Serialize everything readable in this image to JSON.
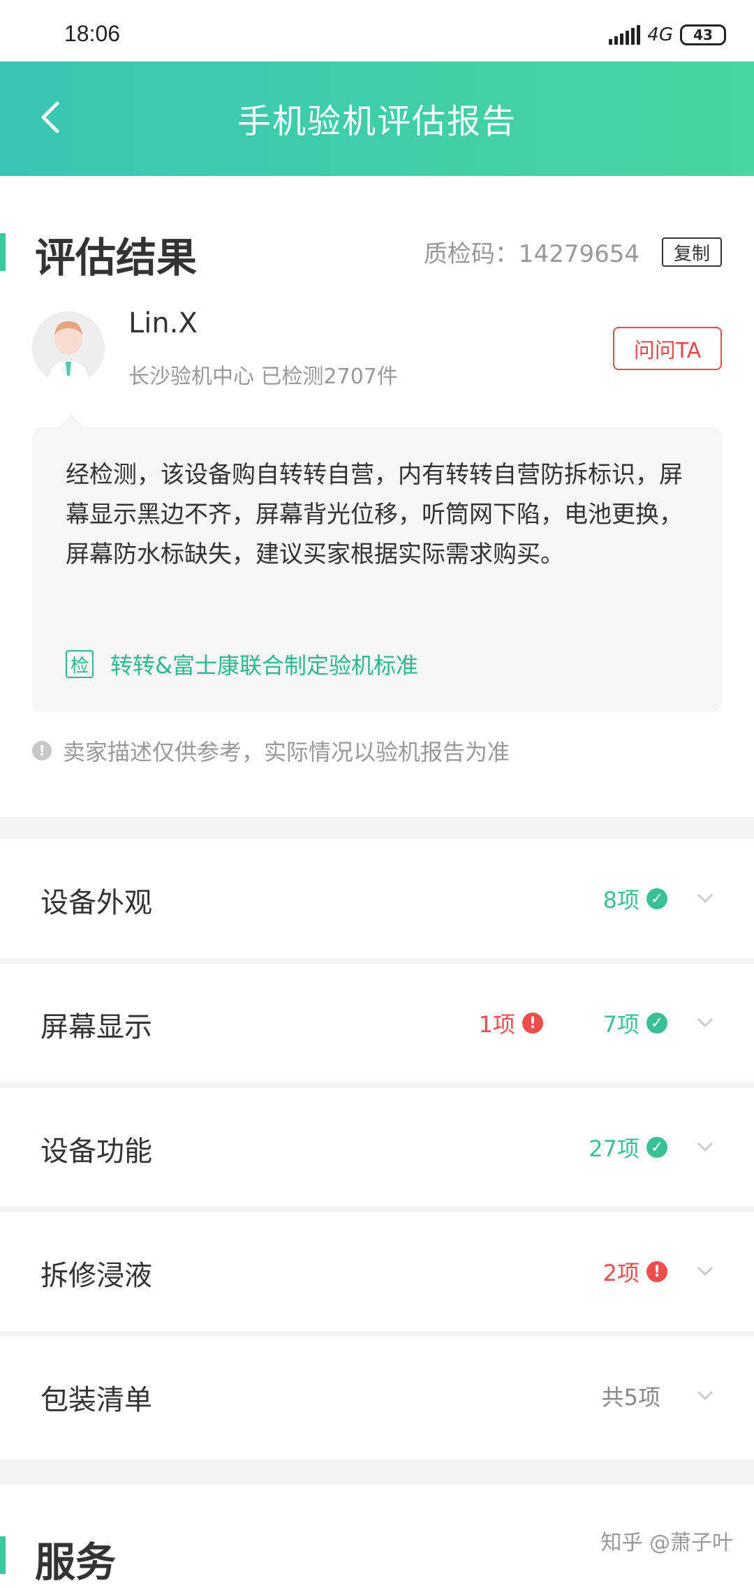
{
  "status_bar": {
    "time": "18:06",
    "network": "4G",
    "battery": "43"
  },
  "header": {
    "title": "手机验机评估报告"
  },
  "result": {
    "title": "评估结果",
    "qc_code": "质检码：14279654",
    "copy_label": "复制",
    "inspector": {
      "name": "Lin.X",
      "meta": "长沙验机中心 已检测2707件",
      "ask_label": "问问TA"
    },
    "summary": "经检测，该设备购自转转自营，内有转转自营防拆标识，屏幕显示黑边不齐，屏幕背光位移，听筒网下陷，电池更换，屏幕防水标缺失，建议买家根据实际需求购买。",
    "standard_badge": "检",
    "standard_text": "转转&富士康联合制定验机标准",
    "note": "卖家描述仅供参考，实际情况以验机报告为准"
  },
  "items": [
    {
      "label": "设备外观",
      "ok": "8项"
    },
    {
      "label": "屏幕显示",
      "bad": "1项",
      "ok": "7项"
    },
    {
      "label": "设备功能",
      "ok": "27项"
    },
    {
      "label": "拆修浸液",
      "bad": "2项"
    },
    {
      "label": "包装清单",
      "neutral": "共5项"
    }
  ],
  "service": {
    "title": "服务"
  },
  "watermark": "知乎 @萧子叶",
  "colors": {
    "accent": "#3bc8a0",
    "ok": "#3bbf94",
    "bad": "#ef4d4d",
    "header_start": "#38c6b3",
    "header_end": "#48d5a1"
  },
  "icons": [
    "back-arrow-icon",
    "check-circle-icon",
    "alert-circle-icon",
    "chevron-down-icon",
    "info-icon",
    "avatar-icon"
  ]
}
